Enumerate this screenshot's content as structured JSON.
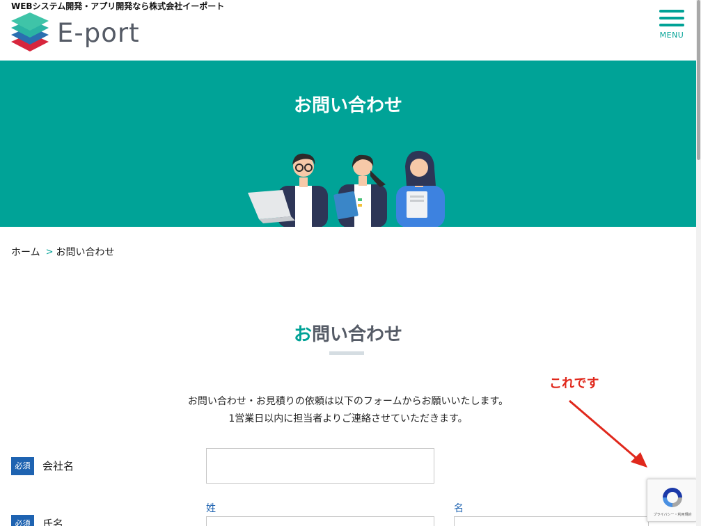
{
  "header": {
    "tagline": "WEBシステム開発・アプリ開発なら株式会社イーポート",
    "logo_text": "E-port",
    "menu_label": "MENU",
    "menu_icon": "hamburger-icon"
  },
  "hero": {
    "title": "お問い合わせ"
  },
  "breadcrumb": {
    "home": "ホーム",
    "separator": ">",
    "current": "お問い合わせ"
  },
  "section": {
    "title_accent": "お",
    "title_rest": "問い合わせ"
  },
  "annotation": {
    "text": "これです"
  },
  "intro": {
    "line1": "お問い合わせ・お見積りの依頼は以下のフォームからお願いいたします。",
    "line2": "1営業日以内に担当者よりご連絡させていただきます。"
  },
  "form": {
    "required_badge": "必須",
    "company_label": "会社名",
    "company_value": "",
    "name_label": "氏名",
    "last_name_label": "姓",
    "first_name_label": "名",
    "last_name_value": "",
    "first_name_value": ""
  },
  "recaptcha": {
    "text": "プライバシー・利用規約"
  },
  "colors": {
    "brand_teal": "#00a397",
    "required_blue": "#1e63b1",
    "annotation_red": "#e0281c",
    "logo_gray": "#555b66"
  }
}
